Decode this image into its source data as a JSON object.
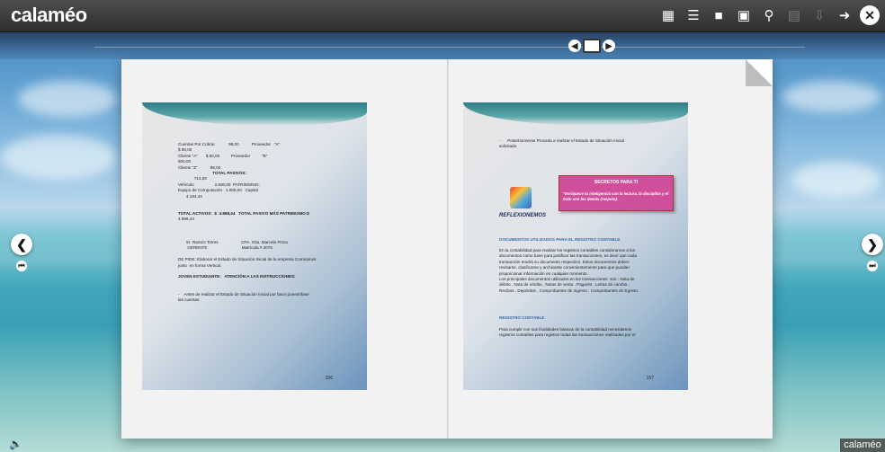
{
  "app": {
    "name": "calaméo"
  },
  "toolbar": {
    "icons": [
      "book-icon",
      "list-icon",
      "fullscreen-icon",
      "zoom-page-icon",
      "search-icon",
      "print-icon",
      "download-icon",
      "share-icon",
      "close-icon"
    ]
  },
  "left_page": {
    "lines": [
      "Cuentas Por Cobrar            98,00           Proveedor   \"A\"",
      "$ 80,00",
      "Cliente \"A\"       $ 50,00          Proveedor          \"B\"",
      "600,00",
      "Cliente \"Z\"           98,00",
      "                              TOTAL PASIVOS:",
      "              714,00",
      "Vehículo                  2.600,00  PATRIMONIO:",
      "Equipo de Computación   1.000,00   Capital",
      "       4.184,44",
      "",
      "",
      "TOTAL ACTIVOS:  $  4.898,44   TOTAL PASIVO MÁS PATRIMONIO:$",
      "4.898,44",
      "",
      "",
      "",
      "       Sr. Ramiro Torres                    CPA. Srta. Marcela Pinza",
      "        GERENTE                              Matrícula # 3076",
      "",
      "DE PIDE: Elaborar el Estado de Situación Inicial de la empresa Comnamos",
      "junto  en forma Vertical.",
      "",
      "JOVEN ESTUDIANTE:   ATENCIÓN A LAS INSTRUCCIONES:",
      "",
      "",
      "-    Antes de realizar el Estado de Situación Inicial por favor ponerinfase",
      "las cuentas."
    ],
    "page_number": "156"
  },
  "right_page": {
    "intro": [
      "-      Posteriormente Proceda a realizar el Estado de Situación Inicial",
      "solicitado."
    ],
    "box_title": "SECRETOS PARA TI",
    "box_text": "\"Enriquece tu inteligencia con la lectura, la disciplina y el trato con las demás (respeto).",
    "reflect_label": "REFLEXIONEMOS",
    "section1_title": "DOCUMENTOS UTILIZADOS PARA EL REGISTRO CONTABLE",
    "section1_lines": [
      "En la contabilidad para realizar los registros contables consideramos a los",
      "documentos como base para justificar las transacciones, es decir que cada",
      "transacción tendrá su documento respectivo. Estos documentos deben",
      "revisarse, clasificarse y archivarse convenientemente para que puedan",
      "proporcionar información en cualquier momento.",
      "Los principales documentos utilizados en las transacciones  son : Nota de",
      "débito , Nota de crédito , Notas de venta , Pagarés , Letras de cambio ,",
      "Recibos , Depósitos , Comprobantes de Ingreso , Comprobantes de Egreso."
    ],
    "section2_title": "REGISTRO CONTABLE",
    "section2_lines": [
      "Para cumplir con sus finalidades básicas de la contabilidad necesitamos",
      "registros contables para registrar todas las transacciones realizadas por el"
    ],
    "page_number": "157"
  },
  "footer": {
    "brand": "calaméo"
  }
}
